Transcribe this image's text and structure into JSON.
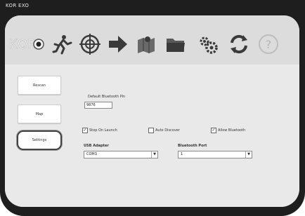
{
  "window": {
    "title": "KOR EXO"
  },
  "toolbar": {
    "logo_text": "KOR",
    "icons": [
      "run-icon",
      "target-icon",
      "arrow-icon",
      "map-icon",
      "folder-icon",
      "settings-gears-icon",
      "refresh-icon",
      "help-icon"
    ],
    "help_glyph": "?"
  },
  "sidebar": {
    "items": [
      {
        "label": "Rescan"
      },
      {
        "label": "Map"
      },
      {
        "label": "Settings",
        "selected": true
      }
    ]
  },
  "settings": {
    "pin_label": "Default Bluetooth Pin",
    "pin_value": "9876",
    "checkboxes": [
      {
        "label": "Stop On Launch",
        "checked": true
      },
      {
        "label": "Auto Discover",
        "checked": false
      },
      {
        "label": "Allow Bluetooth",
        "checked": true
      }
    ],
    "usb_label": "USB Adapter",
    "usb_value": "COM3",
    "bt_port_label": "Bluetooth Port",
    "bt_port_value": "1"
  },
  "colors": {
    "accent_orange": "#d05a1e",
    "device_frame": "#1e1e1e"
  }
}
